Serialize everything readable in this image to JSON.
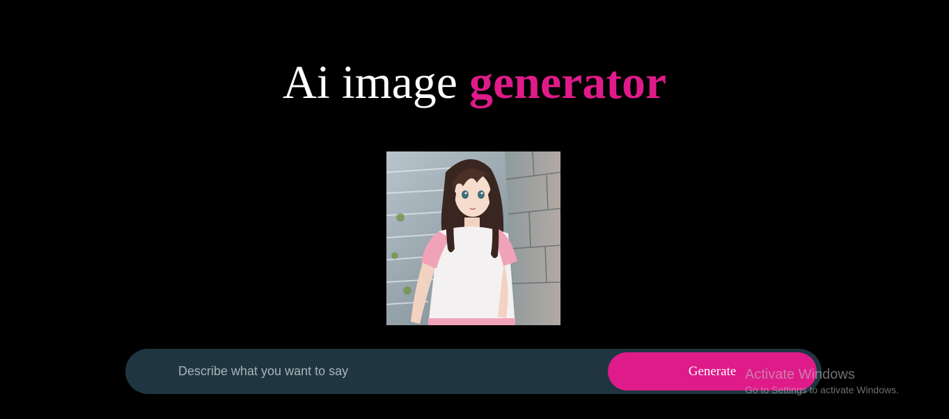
{
  "header": {
    "title_plain": "Ai image ",
    "title_accent": "generator"
  },
  "generated_image": {
    "alt": "Generated anime-style illustration of a girl in a pink and white t-shirt leaning against a stone wall"
  },
  "prompt": {
    "placeholder": "Describe what you want to say",
    "value": "",
    "button_label": "Generate"
  },
  "watermark": {
    "title": "Activate Windows",
    "subtitle": "Go to Settings to activate Windows."
  },
  "colors": {
    "background": "#000000",
    "accent": "#de1b89",
    "prompt_bar": "#1f3540",
    "title": "#ffffff"
  }
}
